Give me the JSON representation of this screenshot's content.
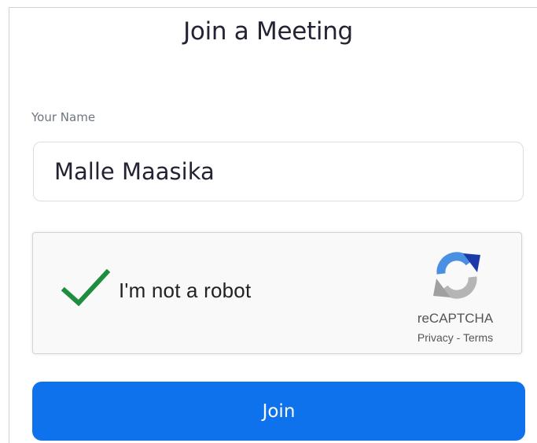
{
  "page": {
    "title": "Join a Meeting"
  },
  "name_field": {
    "label": "Your Name",
    "value": "Malle Maasika"
  },
  "captcha": {
    "checkbox_label": "I'm not a robot",
    "checked": true,
    "check_color": "#1e8e3e",
    "brand": "reCAPTCHA",
    "privacy_link": "Privacy",
    "separator": "-",
    "terms_link": "Terms",
    "logo_icon": "recaptcha-logo-icon"
  },
  "join": {
    "label": "Join"
  },
  "colors": {
    "accent": "#0e72ed",
    "text": "#232333",
    "label": "#6e7680"
  }
}
